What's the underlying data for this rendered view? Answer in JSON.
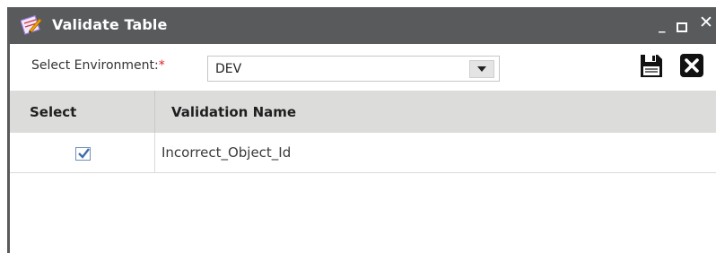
{
  "window": {
    "title": "Validate Table",
    "min_label": "_",
    "close_label": "✕",
    "title_bar_color": "#585a5c"
  },
  "toolbar": {
    "env_label": "Select Environment:",
    "env_required": "*",
    "env_value": "DEV",
    "save_icon": "save-icon",
    "close_icon": "close-icon"
  },
  "grid": {
    "headers": [
      "Select",
      "Validation Name"
    ],
    "rows": [
      {
        "selected": true,
        "name": "Incorrect_Object_Id"
      }
    ]
  },
  "colors": {
    "required": "#e0202a",
    "checkbox": "#3f6da8"
  }
}
